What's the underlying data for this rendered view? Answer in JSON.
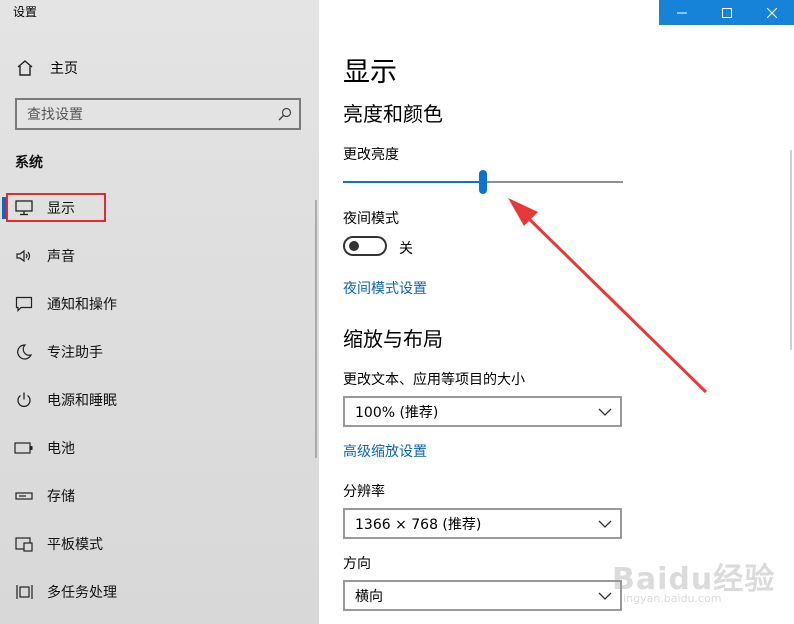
{
  "window": {
    "title": "设置"
  },
  "sidebar": {
    "home_label": "主页",
    "search_placeholder": "查找设置",
    "section": "系统",
    "items": [
      {
        "label": "显示",
        "icon": "monitor-icon",
        "active": true
      },
      {
        "label": "声音",
        "icon": "speaker-icon"
      },
      {
        "label": "通知和操作",
        "icon": "message-icon"
      },
      {
        "label": "专注助手",
        "icon": "moon-icon"
      },
      {
        "label": "电源和睡眠",
        "icon": "power-icon"
      },
      {
        "label": "电池",
        "icon": "battery-icon"
      },
      {
        "label": "存储",
        "icon": "storage-icon"
      },
      {
        "label": "平板模式",
        "icon": "tablet-icon"
      },
      {
        "label": "多任务处理",
        "icon": "multitask-icon"
      }
    ]
  },
  "main": {
    "title": "显示",
    "brightness_section": "亮度和颜色",
    "brightness_label": "更改亮度",
    "brightness_value": 0.5,
    "night_mode_label": "夜间模式",
    "night_mode_state": "关",
    "night_mode_link": "夜间模式设置",
    "scale_section": "缩放与布局",
    "scale_label": "更改文本、应用等项目的大小",
    "scale_value": "100% (推荐)",
    "advanced_scale_link": "高级缩放设置",
    "resolution_label": "分辨率",
    "resolution_value": "1366 × 768 (推荐)",
    "orientation_label": "方向",
    "orientation_value": "横向"
  },
  "watermark": {
    "brand": "Baidu经验",
    "url": "jingyan.baidu.com"
  },
  "colors": {
    "accent": "#0a74cf",
    "titlebar": "#1683d8",
    "highlight": "#e52a2a",
    "link": "#0b63b8"
  }
}
